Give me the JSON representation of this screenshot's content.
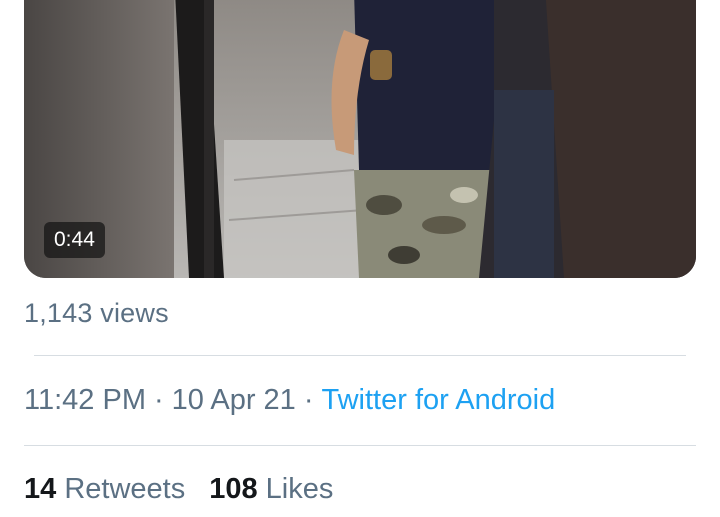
{
  "tweet": {
    "video": {
      "duration": "0:44"
    },
    "views": "1,143 views",
    "timestamp": {
      "time": "11:42 PM",
      "separator": "·",
      "date": "10 Apr 21",
      "source": "Twitter for Android"
    },
    "stats": {
      "retweets_count": "14",
      "retweets_label": "Retweets",
      "likes_count": "108",
      "likes_label": "Likes"
    }
  },
  "colors": {
    "secondary_text": "#5b7083",
    "link": "#1da1f2",
    "primary_text": "#14171a",
    "divider": "#d7dde2"
  }
}
